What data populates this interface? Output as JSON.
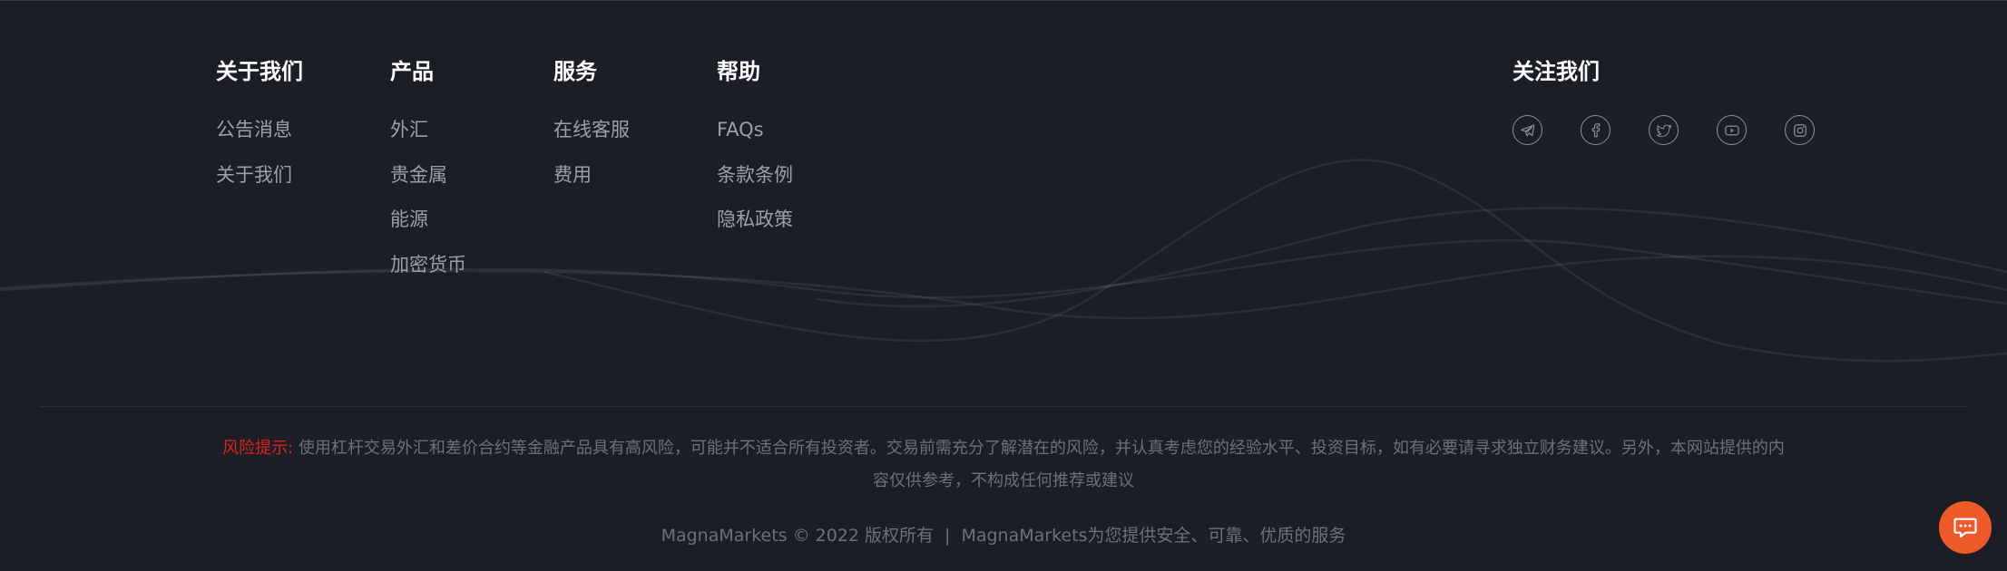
{
  "columns": [
    {
      "title": "关于我们",
      "links": [
        "公告消息",
        "关于我们"
      ]
    },
    {
      "title": "产品",
      "links": [
        "外汇",
        "贵金属",
        "能源",
        "加密货币"
      ]
    },
    {
      "title": "服务",
      "links": [
        "在线客服",
        "费用"
      ]
    },
    {
      "title": "帮助",
      "links": [
        "FAQs",
        "条款条例",
        "隐私政策"
      ]
    }
  ],
  "social": {
    "title": "关注我们",
    "icons": [
      "telegram-icon",
      "facebook-icon",
      "twitter-icon",
      "youtube-icon",
      "instagram-icon"
    ]
  },
  "risk": {
    "label": "风险提示:",
    "text": " 使用杠杆交易外汇和差价合约等金融产品具有高风险，可能并不适合所有投资者。交易前需充分了解潜在的风险，并认真考虑您的经验水平、投资目标，如有必要请寻求独立财务建议。另外，本网站提供的内容仅供参考，不构成任何推荐或建议"
  },
  "copyright": {
    "left": "MagnaMarkets © 2022 版权所有",
    "separator": "|",
    "right": "MagnaMarkets为您提供安全、可靠、优质的服务"
  },
  "colors": {
    "background": "#1b1f25",
    "heading": "#ffffff",
    "link": "#9aa0a8",
    "muted": "#6b7079",
    "risk_label": "#e02020",
    "chat_button": "#ef5a2b"
  },
  "chat": {
    "icon": "chat-bubble-icon"
  }
}
